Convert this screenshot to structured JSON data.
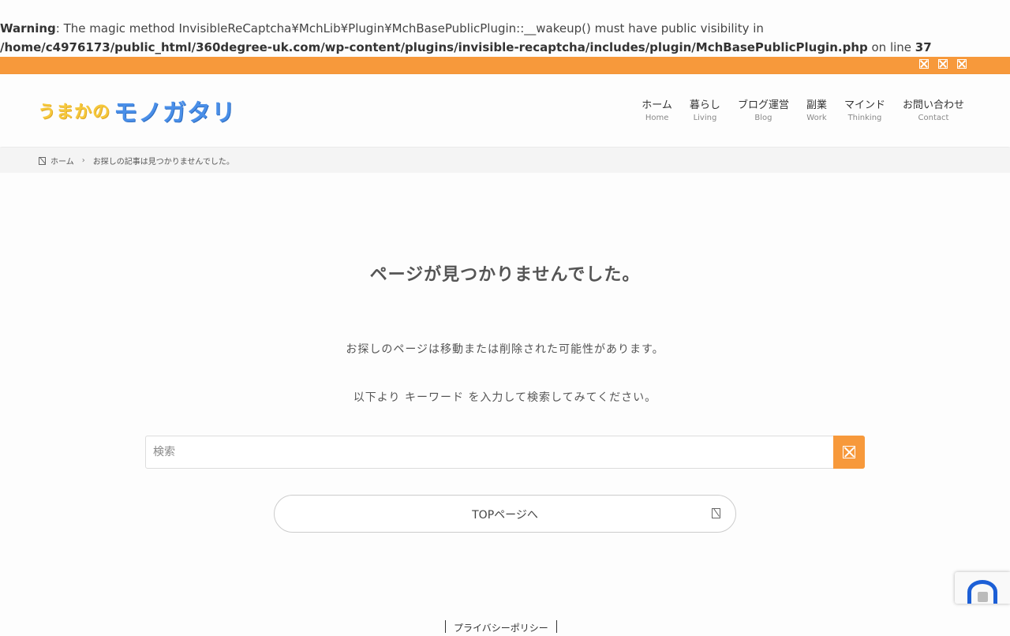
{
  "warning": {
    "label": "Warning",
    "text1": ": The magic method InvisibleReCaptcha¥MchLib¥Plugin¥MchBasePublicPlugin::__wakeup() must have public visibility in ",
    "path": "/home/c4976173/public_html/360degree-uk.com/wp-content/plugins/invisible-recaptcha/includes/plugin/MchBasePublicPlugin.php",
    "text2": " on line ",
    "line": "37"
  },
  "colors": {
    "accent": "#f7993b",
    "logo_yellow": "#f6c83b",
    "logo_blue": "#4a8fe8"
  },
  "topbar": {
    "icons": [
      "social-icon-1",
      "social-icon-2",
      "social-icon-3"
    ]
  },
  "logo": {
    "part1": "うまかの",
    "part2": "モノガタリ"
  },
  "nav": [
    {
      "jp": "ホーム",
      "en": "Home"
    },
    {
      "jp": "暮らし",
      "en": "Living"
    },
    {
      "jp": "ブログ運営",
      "en": "Blog"
    },
    {
      "jp": "副業",
      "en": "Work"
    },
    {
      "jp": "マインド",
      "en": "Thinking"
    },
    {
      "jp": "お問い合わせ",
      "en": "Contact"
    }
  ],
  "breadcrumb": {
    "home": "ホーム",
    "current": "お探しの記事は見つかりませんでした。"
  },
  "main": {
    "title": "ページが見つかりませんでした。",
    "message1": "お探しのページは移動または削除された可能性があります。",
    "message2": "以下より キーワード を入力して検索してみてください。",
    "search_placeholder": "検索",
    "top_button": "TOPページへ"
  },
  "footer": {
    "privacy": "プライバシーポリシー"
  }
}
